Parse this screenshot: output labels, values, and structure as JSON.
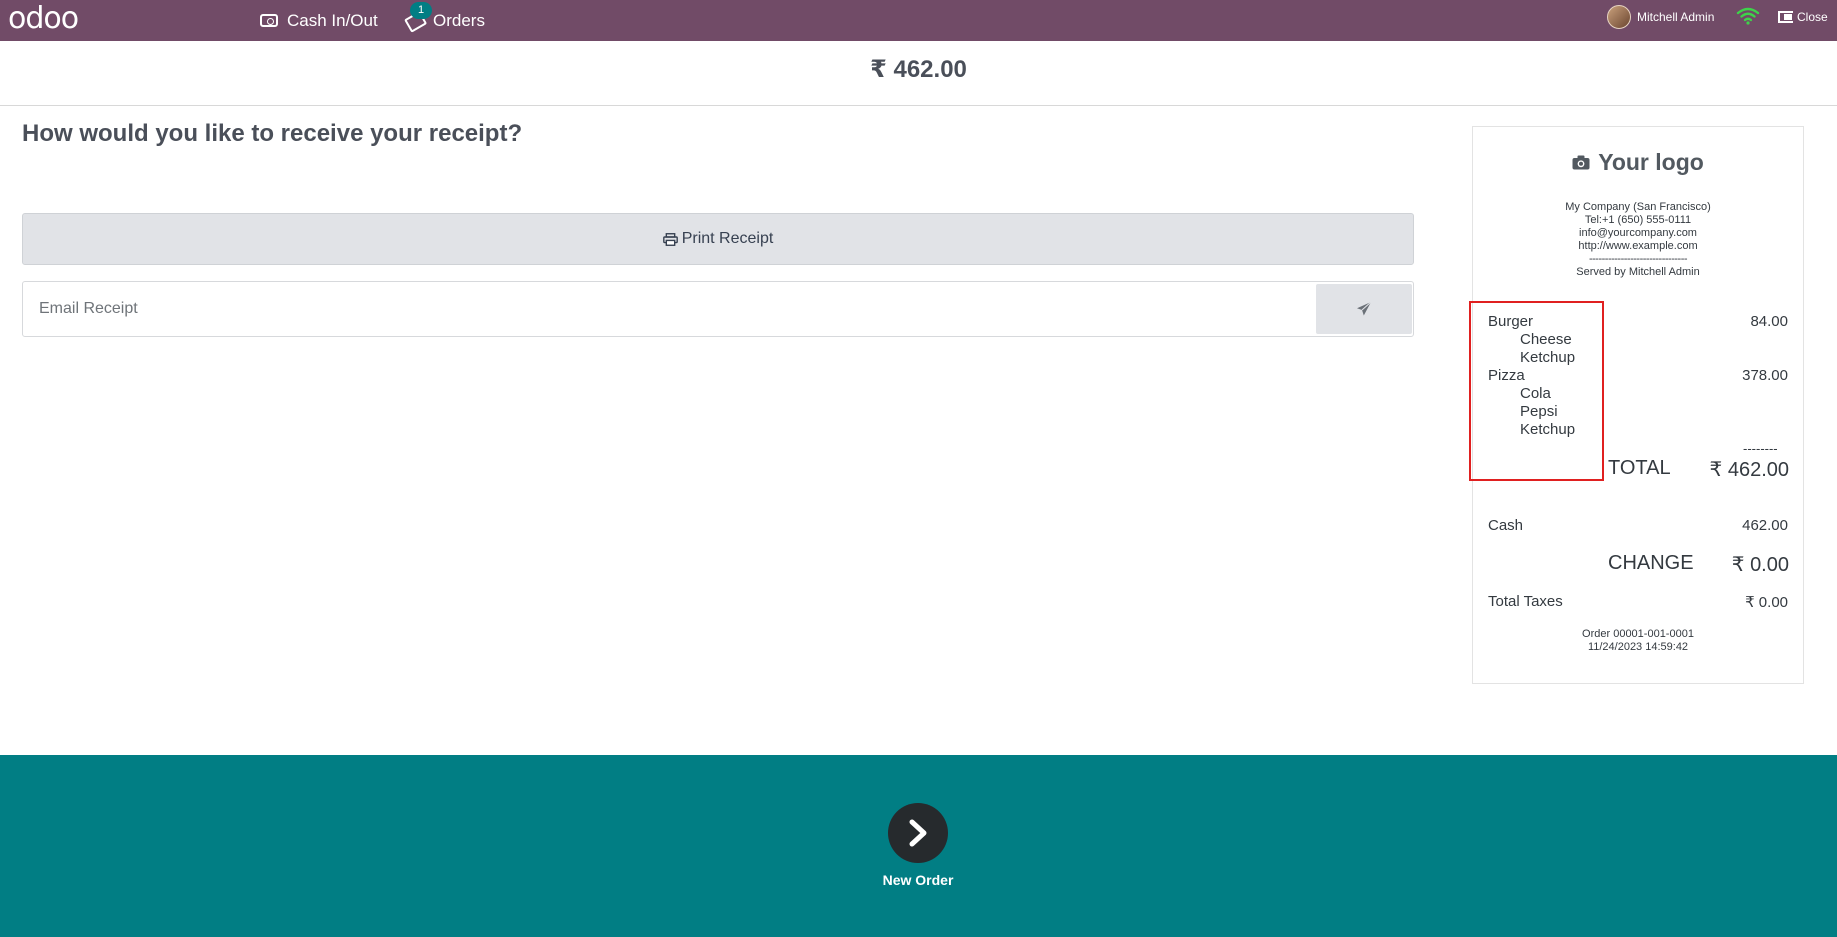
{
  "brand": {
    "logo_text": "odoo",
    "topbar_color": "#714B67",
    "accent_color": "#017e84"
  },
  "topbar": {
    "cash_label": "Cash In/Out",
    "orders_label": "Orders",
    "orders_badge": "1",
    "user_name": "Mitchell Admin",
    "close_label": "Close"
  },
  "header": {
    "amount": "₹ 462.00"
  },
  "main": {
    "question": "How would you like to receive your receipt?",
    "print_label": "Print Receipt",
    "email_placeholder": "Email Receipt"
  },
  "receipt": {
    "logo_text": "Your logo",
    "company_lines": [
      "My Company (San Francisco)",
      "Tel:+1 (650) 555-0111",
      "info@yourcompany.com",
      "http://www.example.com",
      "-------------------------------",
      "Served by Mitchell Admin"
    ],
    "lines": [
      {
        "name": "Burger",
        "price": "84.00",
        "sub": false
      },
      {
        "name": "Cheese",
        "price": "",
        "sub": true
      },
      {
        "name": "Ketchup",
        "price": "",
        "sub": true
      },
      {
        "name": "Pizza",
        "price": "378.00",
        "sub": false
      },
      {
        "name": "Cola",
        "price": "",
        "sub": true
      },
      {
        "name": "Pepsi",
        "price": "",
        "sub": true
      },
      {
        "name": "Ketchup",
        "price": "",
        "sub": true
      }
    ],
    "separator": "--------",
    "total_label": "TOTAL",
    "total_value": "₹ 462.00",
    "cash_label": "Cash",
    "cash_value": "462.00",
    "change_label": "CHANGE",
    "change_value": "₹ 0.00",
    "taxes_label": "Total Taxes",
    "taxes_value": "₹ 0.00",
    "order_ref": "Order 00001-001-0001",
    "order_date": "11/24/2023 14:59:42"
  },
  "footer": {
    "next_label": "New Order"
  }
}
